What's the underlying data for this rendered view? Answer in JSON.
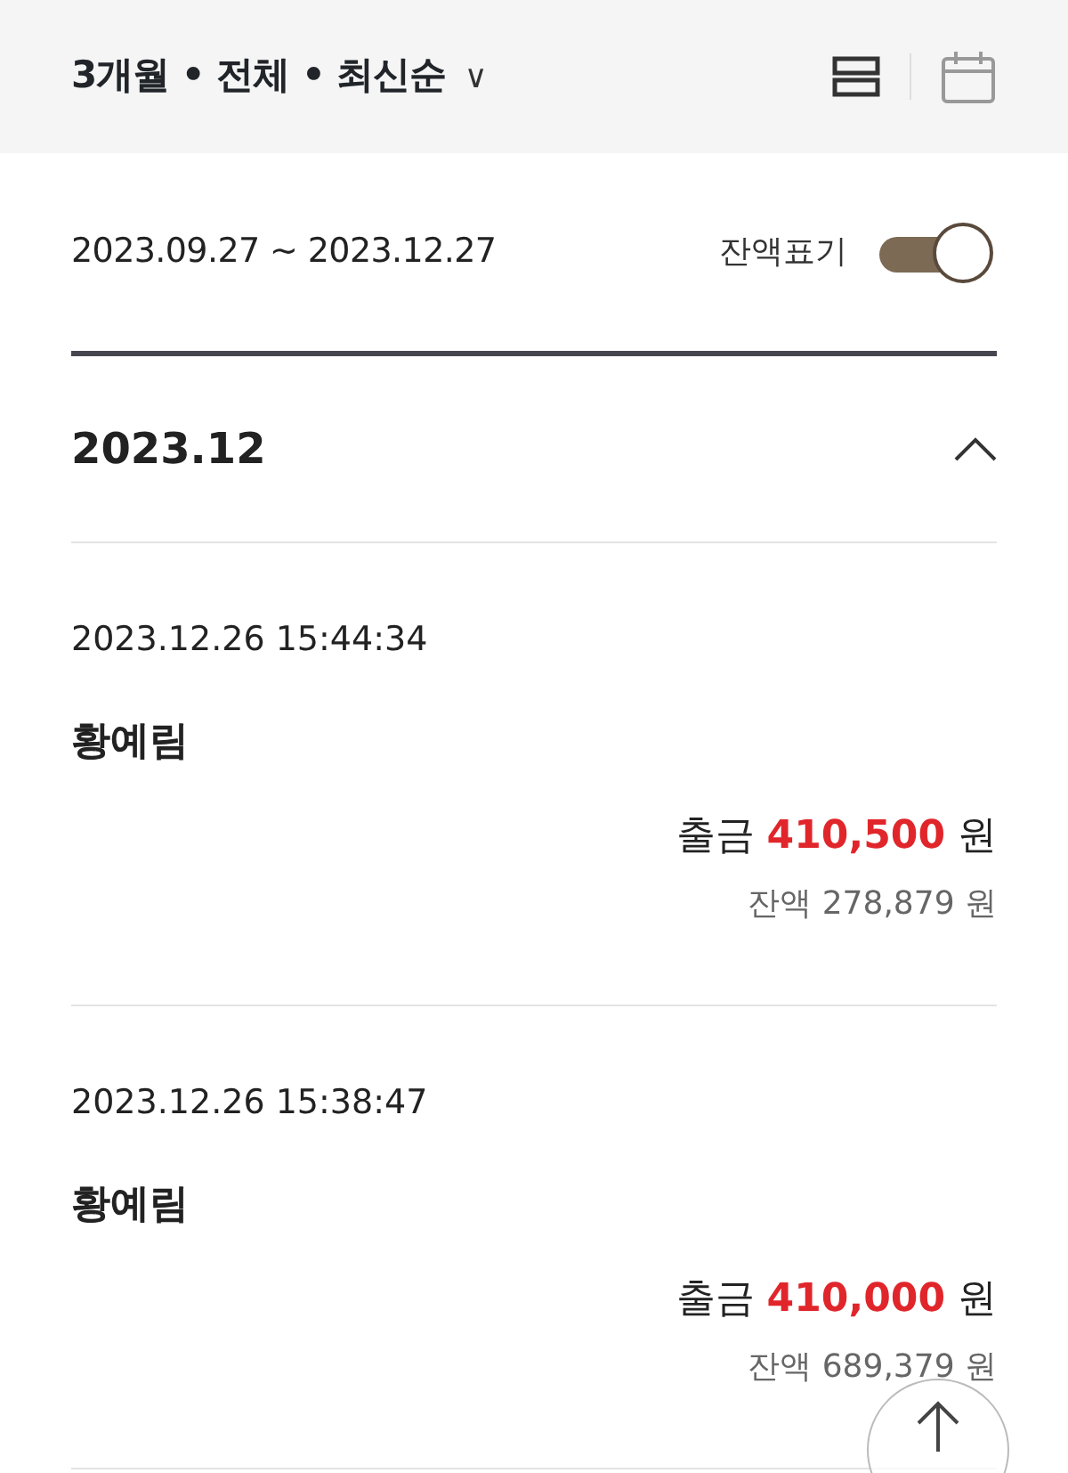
{
  "header": {
    "filter": "3개월 • 전체 • 최신순",
    "caret": "∨"
  },
  "range": {
    "text": "2023.09.27 ~ 2023.12.27",
    "toggle_label": "잔액표기",
    "balance_on": true
  },
  "month": {
    "label": "2023.12",
    "expanded": true
  },
  "transactions": [
    {
      "datetime": "2023.12.26 15:44:34",
      "name": "황예림",
      "type_label": "출금",
      "amount": "410,500",
      "unit": "원",
      "balance": "잔액 278,879 원"
    },
    {
      "datetime": "2023.12.26 15:38:47",
      "name": "황예림",
      "type_label": "출금",
      "amount": "410,000",
      "unit": "원",
      "balance": "잔액 689,379 원"
    }
  ]
}
